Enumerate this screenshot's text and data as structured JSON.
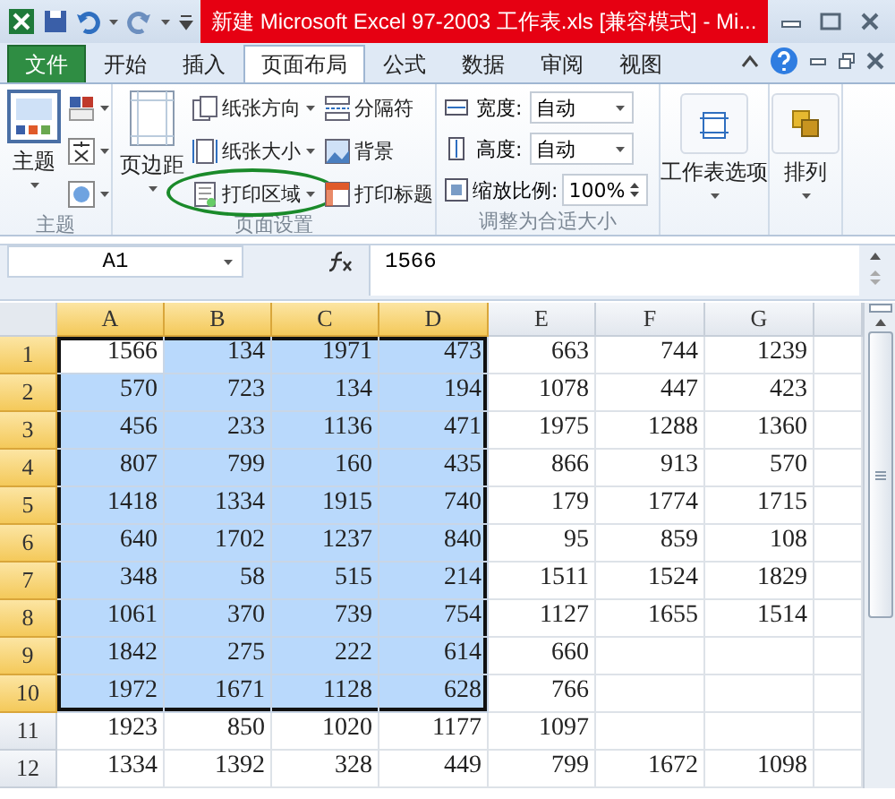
{
  "window": {
    "title": "新建 Microsoft Excel 97-2003 工作表.xls  [兼容模式] - Mi..."
  },
  "tabs": [
    {
      "label": "文件",
      "kind": "file",
      "selected": false
    },
    {
      "label": "开始",
      "kind": "tab",
      "selected": false
    },
    {
      "label": "插入",
      "kind": "tab",
      "selected": false
    },
    {
      "label": "页面布局",
      "kind": "tab",
      "selected": true
    },
    {
      "label": "公式",
      "kind": "tab",
      "selected": false
    },
    {
      "label": "数据",
      "kind": "tab",
      "selected": false
    },
    {
      "label": "审阅",
      "kind": "tab",
      "selected": false
    },
    {
      "label": "视图",
      "kind": "tab",
      "selected": false
    }
  ],
  "ribbon": {
    "theme_group": {
      "label": "主题",
      "button": "主题"
    },
    "page_setup": {
      "label": "页面设置",
      "margins": "页边距",
      "buttons": [
        {
          "label": "纸张方向",
          "circled": false
        },
        {
          "label": "分隔符",
          "circled": false
        },
        {
          "label": "纸张大小",
          "circled": false
        },
        {
          "label": "背景",
          "circled": false
        },
        {
          "label": "打印区域",
          "circled": true
        },
        {
          "label": "打印标题",
          "circled": false
        }
      ]
    },
    "scale_to_fit": {
      "label": "调整为合适大小",
      "fields": [
        {
          "label": "宽度:",
          "value": "自动",
          "kind": "dropdown"
        },
        {
          "label": "高度:",
          "value": "自动",
          "kind": "dropdown"
        },
        {
          "label": "缩放比例:",
          "value": "100%",
          "kind": "spin"
        }
      ]
    },
    "sheet_options": "工作表选项",
    "arrange": "排列"
  },
  "formula_bar": {
    "name_box": "A1",
    "value": "1566"
  },
  "sheet": {
    "columns": [
      {
        "label": "A",
        "selected": true
      },
      {
        "label": "B",
        "selected": true
      },
      {
        "label": "C",
        "selected": true
      },
      {
        "label": "D",
        "selected": true
      },
      {
        "label": "E",
        "selected": false
      },
      {
        "label": "F",
        "selected": false
      },
      {
        "label": "G",
        "selected": false
      }
    ],
    "rows": [
      {
        "header": "1",
        "selected": true,
        "cells": [
          {
            "value": "1566",
            "active": true
          },
          "134",
          "1971",
          "473",
          "663",
          "744",
          "1239"
        ]
      },
      {
        "header": "2",
        "selected": true,
        "cells": [
          "570",
          "723",
          "134",
          "194",
          "1078",
          "447",
          "423"
        ]
      },
      {
        "header": "3",
        "selected": true,
        "cells": [
          "456",
          "233",
          "1136",
          "471",
          "1975",
          "1288",
          "1360"
        ]
      },
      {
        "header": "4",
        "selected": true,
        "cells": [
          "807",
          "799",
          "160",
          "435",
          "866",
          "913",
          "570"
        ]
      },
      {
        "header": "5",
        "selected": true,
        "cells": [
          "1418",
          "1334",
          "1915",
          "740",
          "179",
          "1774",
          "1715"
        ]
      },
      {
        "header": "6",
        "selected": true,
        "cells": [
          "640",
          "1702",
          "1237",
          "840",
          "95",
          "859",
          "108"
        ]
      },
      {
        "header": "7",
        "selected": true,
        "cells": [
          "348",
          "58",
          "515",
          "214",
          "1511",
          "1524",
          "1829"
        ]
      },
      {
        "header": "8",
        "selected": true,
        "cells": [
          "1061",
          "370",
          "739",
          "754",
          "1127",
          "1655",
          "1514"
        ]
      },
      {
        "header": "9",
        "selected": true,
        "cells": [
          "1842",
          "275",
          "222",
          "614",
          "660",
          null,
          null
        ]
      },
      {
        "header": "10",
        "selected": true,
        "cells": [
          "1972",
          "1671",
          "1128",
          "628",
          "766",
          null,
          null
        ]
      },
      {
        "header": "11",
        "selected": false,
        "cells": [
          "1923",
          "850",
          "1020",
          "1177",
          "1097",
          null,
          null
        ]
      },
      {
        "header": "12",
        "selected": false,
        "cells": [
          "1334",
          "1392",
          "328",
          "449",
          "799",
          "1672",
          "1098"
        ]
      }
    ]
  }
}
